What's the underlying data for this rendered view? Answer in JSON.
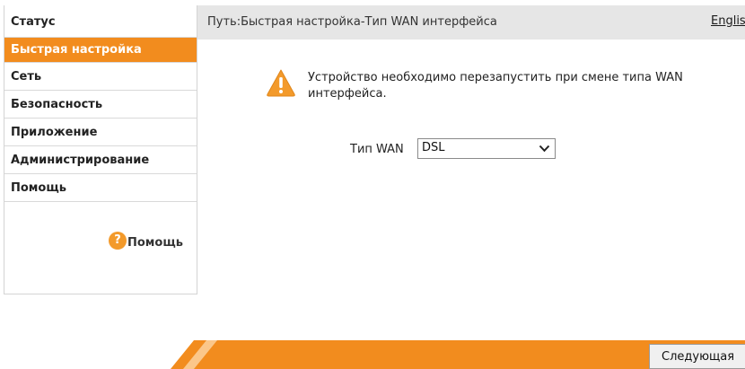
{
  "sidebar": {
    "items": [
      {
        "label": "Статус"
      },
      {
        "label": "Быстрая настройка"
      },
      {
        "label": "Сеть"
      },
      {
        "label": "Безопасность"
      },
      {
        "label": "Приложение"
      },
      {
        "label": "Администрирование"
      },
      {
        "label": "Помощь"
      }
    ],
    "help": {
      "icon": "?",
      "label": "Помощь"
    }
  },
  "header": {
    "breadcrumb": "Путь:Быстрая настройка-Тип WAN интерфейса",
    "language": "English"
  },
  "warning": {
    "icon": "warning-icon",
    "text": "Устройство необходимо перезапустить при смене типа WAN интерфейса."
  },
  "wan": {
    "label": "Тип WAN",
    "selected": "DSL"
  },
  "footer": {
    "next_label": "Следующая"
  },
  "colors": {
    "accent": "#f28c1e",
    "header_bg": "#e6e6e6",
    "warning": "#f39a2b"
  }
}
